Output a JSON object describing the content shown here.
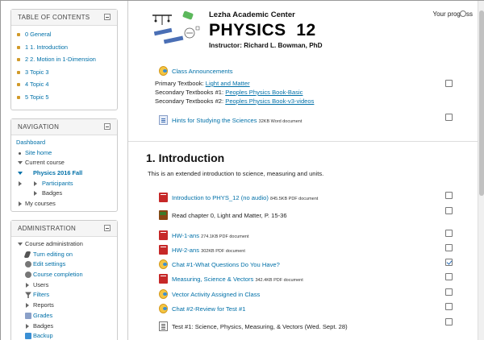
{
  "toc": {
    "title": "TABLE OF CONTENTS",
    "items": [
      "0 General",
      "1 1. Introduction",
      "2 2. Motion in 1-Dimension",
      "3 Topic 3",
      "4 Topic 4",
      "5 Topic 5"
    ]
  },
  "navigation": {
    "title": "NAVIGATION",
    "dashboard": "Dashboard",
    "site_home": "Site home",
    "current_course": "Current course",
    "course": "Physics 2016 Fall",
    "participants": "Participants",
    "badges": "Badges",
    "my_courses": "My courses"
  },
  "administration": {
    "title": "ADMINISTRATION",
    "course_admin": "Course administration",
    "items": [
      "Turn editing on",
      "Edit settings",
      "Course completion",
      "Users",
      "Filters",
      "Reports",
      "Grades",
      "Badges",
      "Backup"
    ]
  },
  "header": {
    "center": "Lezha Academic Center",
    "title": "PHYSICS  12",
    "instructor": "Instructor: Richard L. Bowman, PhD",
    "progress": "Your progress"
  },
  "general": {
    "announcements": "Class Announcements",
    "primary_label": "Primary Textbook: ",
    "primary_link": "Light and Matter",
    "secondary1_label": "Secondary Textbooks #1: ",
    "secondary1_link": "Peoples Physics Book-Basic",
    "secondary2_label": "Secondary Textbooks #2: ",
    "secondary2_link": "Peoples Physics Book-v3-videos",
    "hints_link": "Hints for Studying the Sciences",
    "hints_meta": "32KB Word document"
  },
  "section1": {
    "heading": "1. Introduction",
    "summary": "This is an extended introduction to science, measuring and units.",
    "items": [
      {
        "label": "Introduction to PHYS_12 (no audio)",
        "meta": "845.5KB PDF document",
        "checked": false
      },
      {
        "label": "Read chapter 0, Light and Matter, P. 15-36",
        "meta": "",
        "checked": false
      },
      {
        "label": "HW-1-ans",
        "meta": "274.1KB PDF document",
        "checked": false
      },
      {
        "label": "HW-2-ans",
        "meta": "302KB PDF document",
        "checked": false
      },
      {
        "label": "Chat #1-What Questions Do You Have?",
        "meta": "",
        "checked": true
      },
      {
        "label": "Measuring, Science & Vectors",
        "meta": "342.4KB PDF document",
        "checked": false
      },
      {
        "label": "Vector Activity Assigned in Class",
        "meta": "",
        "checked": false
      },
      {
        "label": "Chat #2-Review for Test #1",
        "meta": "",
        "checked": false
      },
      {
        "label": "Test #1: Science, Physics, Measuring, & Vectors (Wed. Sept. 28)",
        "meta": "",
        "checked": false
      }
    ]
  }
}
